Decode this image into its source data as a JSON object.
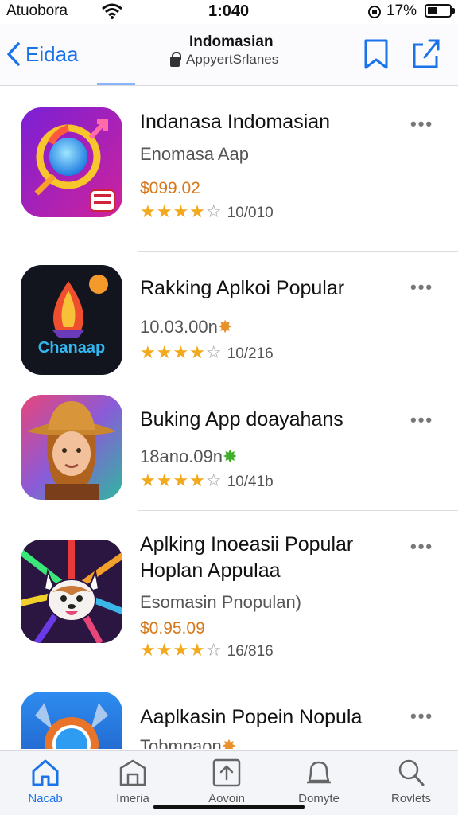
{
  "status_bar": {
    "carrier": "Atuobora",
    "time": "1:040",
    "battery": "17%"
  },
  "nav": {
    "back_label": "Eidaa",
    "title": "Indomasian",
    "subtitle": "AppyertSrlanes"
  },
  "apps": [
    {
      "title": "Indanasa Indomasian",
      "subtitle": "Enomasa Aap",
      "price": "$099.02",
      "rating_count": "10/010",
      "stars": 4,
      "more": "•••",
      "icon_name": "app-icon-purple-orb"
    },
    {
      "title": "Rakking Aplkoi Popular",
      "subtitle": "10.03.00n",
      "rating_count": "10/216",
      "stars": 4,
      "more": "•••",
      "icon_name": "app-icon-chanaap",
      "icon_text": "Chanaap"
    },
    {
      "title": "Buking App doayahans",
      "subtitle": "18ano.09n",
      "rating_count": "10/41b",
      "stars": 4,
      "more": "•••",
      "icon_name": "app-icon-cowboy"
    },
    {
      "title": "Aplking Inoeasii Popular",
      "title2": "Hoplan Appulaa",
      "subtitle": "Esomasin Pnopulan)",
      "price": "$0.95.09",
      "rating_count": "16/816",
      "stars": 4,
      "more": "•••",
      "icon_name": "app-icon-fox"
    },
    {
      "title": "Aaplkasin Popein Nopula",
      "subtitle": "Tobmnaon",
      "more": "•••",
      "icon_name": "app-icon-blue-mask"
    }
  ],
  "tabs": [
    {
      "label": "Nacab",
      "icon": "home-icon",
      "active": true
    },
    {
      "label": "Imeria",
      "icon": "building-icon"
    },
    {
      "label": "Aovoin",
      "icon": "upload-box-icon"
    },
    {
      "label": "Domyte",
      "icon": "bell-icon"
    },
    {
      "label": "Rovlets",
      "icon": "search-icon"
    }
  ],
  "colors": {
    "accent": "#1a73e8",
    "star": "#f2a91b",
    "price": "#d6781a"
  }
}
